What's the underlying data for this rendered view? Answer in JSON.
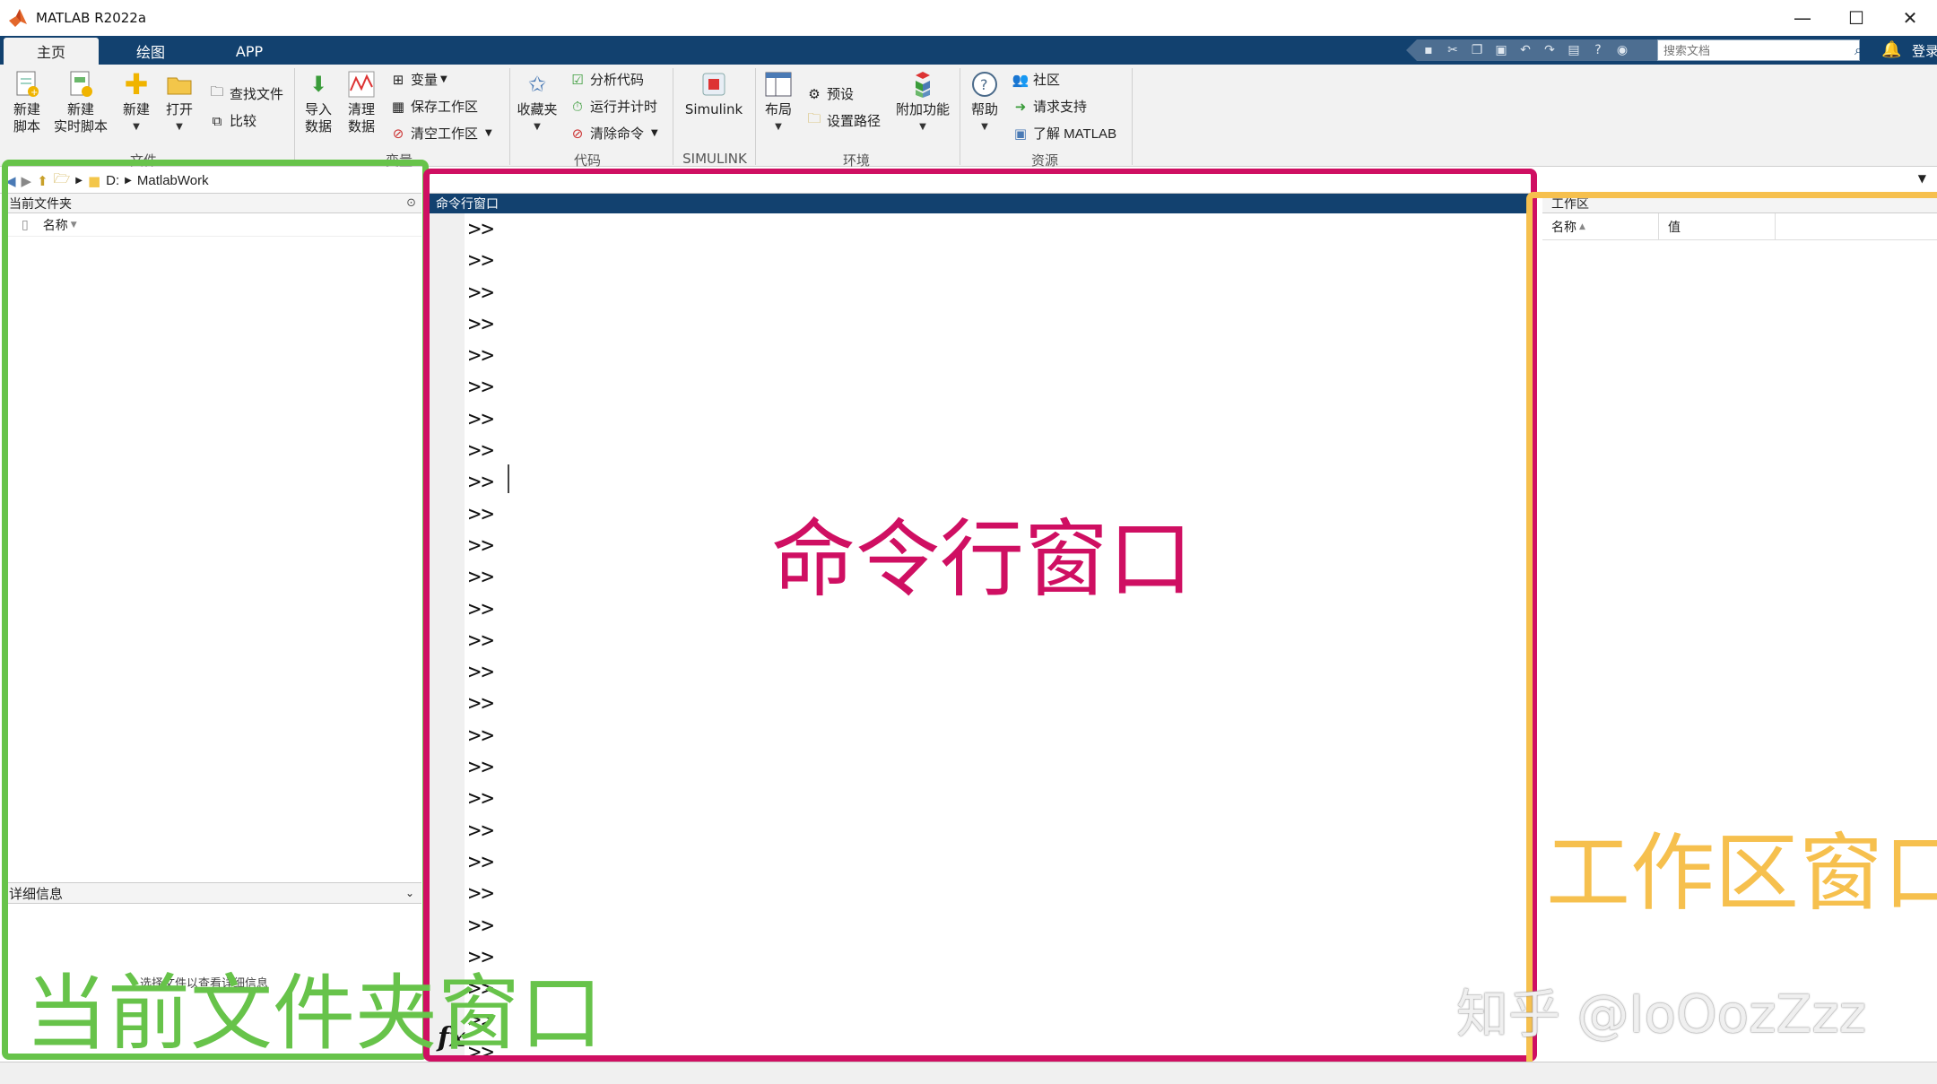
{
  "window": {
    "title": "MATLAB R2022a"
  },
  "window_buttons": {
    "minimize": "—",
    "maximize": "☐",
    "close": "✕"
  },
  "tabs": [
    {
      "label": "主页",
      "active": true
    },
    {
      "label": "绘图",
      "active": false
    },
    {
      "label": "APP",
      "active": false
    }
  ],
  "search": {
    "placeholder": "搜索文档"
  },
  "login": {
    "label": "登录"
  },
  "ribbon": {
    "file": {
      "new_script": "新建\n脚本",
      "new_live_script": "新建\n实时脚本",
      "new": "新建",
      "open": "打开",
      "find_files": "查找文件",
      "compare": "比较",
      "group_label": "文件"
    },
    "variable": {
      "import_data": "导入\n数据",
      "clean_data": "清理\n数据",
      "variable": "变量",
      "save_workspace": "保存工作区",
      "clear_workspace": "清空工作区",
      "group_label": "变量"
    },
    "code": {
      "favorites": "收藏夹",
      "analyze_code": "分析代码",
      "run_and_time": "运行并计时",
      "clear_commands": "清除命令",
      "group_label": "代码"
    },
    "simulink": {
      "simulink": "Simulink",
      "group_label": "SIMULINK"
    },
    "environment": {
      "layout": "布局",
      "preferences": "预设",
      "set_path": "设置路径",
      "addons": "附加功能",
      "group_label": "环境"
    },
    "resources": {
      "help": "帮助",
      "community": "社区",
      "request_support": "请求支持",
      "learn_matlab": "了解 MATLAB",
      "group_label": "资源"
    }
  },
  "address": {
    "drive": "D:",
    "folder": "MatlabWork"
  },
  "folder_panel": {
    "title": "当前文件夹",
    "column_name": "名称",
    "details_title": "详细信息",
    "details_hint": "选择文件以查看详细信息"
  },
  "command_window": {
    "title": "命令行窗口",
    "prompt": ">>",
    "prompt_count": 27,
    "fx": "fx"
  },
  "workspace_panel": {
    "title": "工作区",
    "column_name": "名称",
    "column_value": "值"
  },
  "annotations": {
    "command_label": "命令行窗口",
    "workspace_label": "工作区窗口",
    "folder_label": "当前文件夹窗口",
    "watermark": "知乎 @IoOozZzz"
  },
  "colors": {
    "accent_blue": "#12416f",
    "frame_green": "#67c34a",
    "frame_magenta": "#cf0f62",
    "frame_orange": "#f6c04e"
  }
}
